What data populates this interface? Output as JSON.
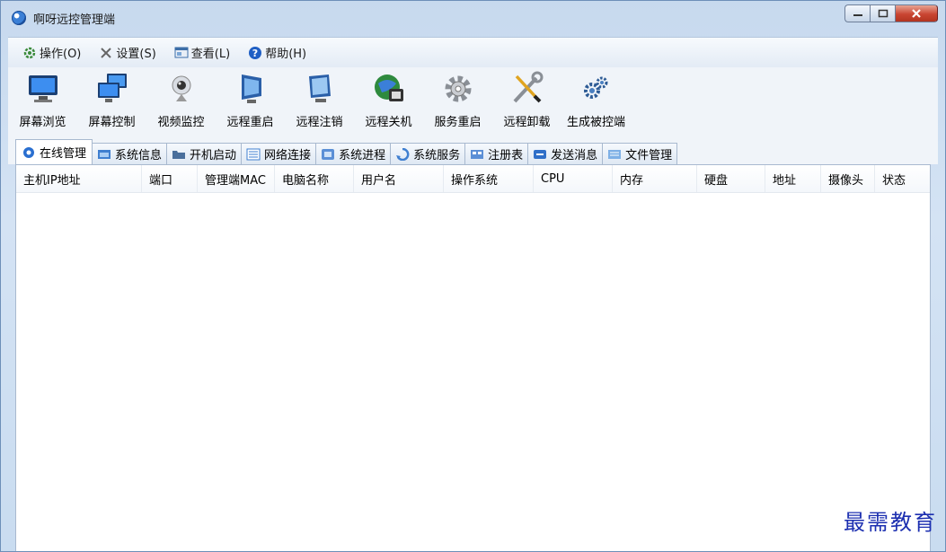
{
  "window": {
    "title": "啊呀远控管理端"
  },
  "menubar": {
    "items": [
      {
        "label": "操作(O)",
        "icon": "settings-gear-icon"
      },
      {
        "label": "设置(S)",
        "icon": "tools-icon"
      },
      {
        "label": "查看(L)",
        "icon": "view-icon"
      },
      {
        "label": "帮助(H)",
        "icon": "help-icon"
      }
    ]
  },
  "toolbar": {
    "items": [
      {
        "label": "屏幕浏览",
        "icon": "monitor-icon"
      },
      {
        "label": "屏幕控制",
        "icon": "dual-monitor-icon"
      },
      {
        "label": "视频监控",
        "icon": "webcam-icon"
      },
      {
        "label": "远程重启",
        "icon": "monitor-restart-icon"
      },
      {
        "label": "远程注销",
        "icon": "monitor-logoff-icon"
      },
      {
        "label": "远程关机",
        "icon": "globe-shutdown-icon"
      },
      {
        "label": "服务重启",
        "icon": "gear-icon"
      },
      {
        "label": "远程卸载",
        "icon": "wrench-screwdriver-icon"
      },
      {
        "label": "生成被控端",
        "icon": "gears-icon"
      }
    ]
  },
  "tabs": [
    {
      "label": "在线管理",
      "active": true
    },
    {
      "label": "系统信息"
    },
    {
      "label": "开机启动"
    },
    {
      "label": "网络连接"
    },
    {
      "label": "系统进程"
    },
    {
      "label": "系统服务"
    },
    {
      "label": "注册表"
    },
    {
      "label": "发送消息"
    },
    {
      "label": "文件管理"
    }
  ],
  "table": {
    "columns": [
      "主机IP地址",
      "端口",
      "管理端MAC",
      "电脑名称",
      "用户名",
      "操作系统",
      "CPU",
      "内存",
      "硬盘",
      "地址",
      "摄像头",
      "状态"
    ],
    "rows": []
  },
  "watermark": "最需教育"
}
